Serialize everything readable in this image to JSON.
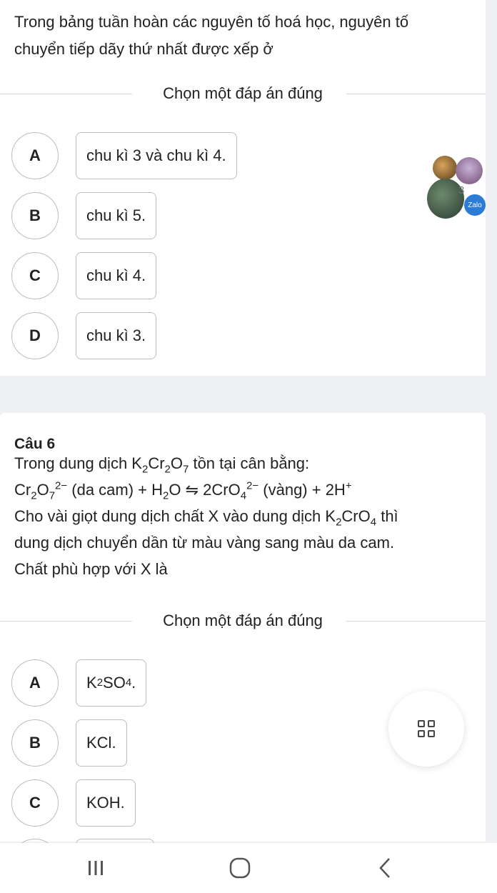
{
  "q1": {
    "text_lines": [
      "Trong bảng tuần hoàn các nguyên tố hoá học, nguyên tố",
      "chuyển tiếp dãy thứ nhất được xếp ở"
    ],
    "prompt": "Chọn một đáp án đúng",
    "options": [
      {
        "letter": "A",
        "text": "chu kì 3 và chu kì 4."
      },
      {
        "letter": "B",
        "text": "chu kì 5."
      },
      {
        "letter": "C",
        "text": "chu kì 4."
      },
      {
        "letter": "D",
        "text": "chu kì 3."
      }
    ]
  },
  "q2": {
    "title": "Câu 6",
    "line1": {
      "pre": "Trong dung dịch K",
      "s1": "2",
      "m1": "Cr",
      "s2": "2",
      "m2": "O",
      "s3": "7",
      "post": " tồn tại cân bằng:"
    },
    "line2": {
      "a": "Cr",
      "s1": "2",
      "b": "O",
      "s2": "7",
      "sup1": "2−",
      "c": " (da cam) + H",
      "s3": "2",
      "d": "O ⇋ 2CrO",
      "s4": "4",
      "sup2": "2−",
      "e": " (vàng) + 2H",
      "sup3": "+"
    },
    "line3": {
      "pre": "Cho vài giọt dung dịch chất X vào dung dịch K",
      "s1": "2",
      "m": "CrO",
      "s2": "4",
      "post": " thì"
    },
    "line4": "dung dịch chuyển dần từ màu vàng sang màu da cam.",
    "line5": "Chất phù hợp với X là",
    "prompt": "Chọn một đáp án đúng",
    "options": [
      {
        "letter": "A",
        "t1": "K",
        "s1": "2",
        "t2": "SO",
        "s2": "4",
        "t3": "."
      },
      {
        "letter": "B",
        "text": "KCl."
      },
      {
        "letter": "C",
        "text": "KOH."
      }
    ]
  },
  "zalo": {
    "count": "3",
    "badge": "Zalo"
  }
}
